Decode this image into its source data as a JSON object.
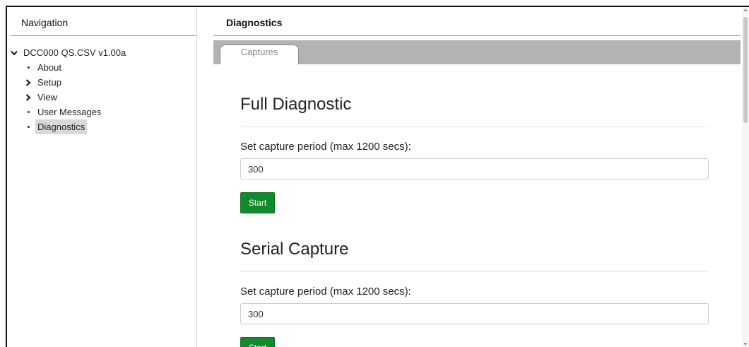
{
  "navigation": {
    "header": "Navigation",
    "root_label": "DCC000 QS.CSV v1.00a",
    "items": [
      {
        "label": "About",
        "type": "leaf"
      },
      {
        "label": "Setup",
        "type": "folder"
      },
      {
        "label": "View",
        "type": "folder"
      },
      {
        "label": "User Messages",
        "type": "leaf"
      },
      {
        "label": "Diagnostics",
        "type": "leaf",
        "selected": true
      }
    ]
  },
  "main": {
    "title": "Diagnostics",
    "tabs": [
      {
        "label": "Captures",
        "active": true
      }
    ],
    "sections": [
      {
        "heading": "Full Diagnostic",
        "field_label": "Set capture period (max 1200 secs):",
        "field_value": "300",
        "button_label": "Start"
      },
      {
        "heading": "Serial Capture",
        "field_label": "Set capture period (max 1200 secs):",
        "field_value": "300",
        "button_label": "Start"
      }
    ]
  },
  "colors": {
    "start_button": "#118a2c",
    "tab_bar": "#b3b3b3",
    "selected_item": "#d9d9d9"
  },
  "icons": {
    "expanded": "chevron-down-icon",
    "collapsed": "chevron-right-icon",
    "leaf": "bullet-icon"
  }
}
